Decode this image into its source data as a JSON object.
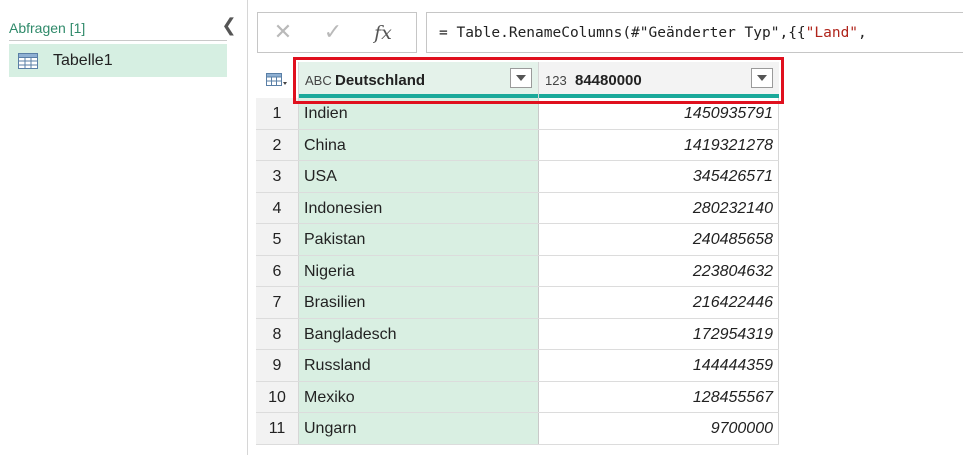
{
  "queries_pane": {
    "title": "Abfragen [1]",
    "collapse_glyph": "❮",
    "items": [
      {
        "label": "Tabelle1",
        "icon": "table-icon"
      }
    ]
  },
  "formula_bar": {
    "cancel_glyph": "✕",
    "commit_glyph": "✓",
    "fx_glyph": "fx",
    "formula_prefix": "= Table.RenameColumns(#\"Geänderter Typ\",{{",
    "formula_string": "\"Land\"",
    "formula_suffix": ","
  },
  "grid": {
    "columns": [
      {
        "type_label": "ABC",
        "name": "Deutschland"
      },
      {
        "type_label": "123",
        "name": "84480000"
      }
    ],
    "rows": [
      {
        "num": "1",
        "land": "Indien",
        "value": "1450935791"
      },
      {
        "num": "2",
        "land": "China",
        "value": "1419321278"
      },
      {
        "num": "3",
        "land": "USA",
        "value": "345426571"
      },
      {
        "num": "4",
        "land": "Indonesien",
        "value": "280232140"
      },
      {
        "num": "5",
        "land": "Pakistan",
        "value": "240485658"
      },
      {
        "num": "6",
        "land": "Nigeria",
        "value": "223804632"
      },
      {
        "num": "7",
        "land": "Brasilien",
        "value": "216422446"
      },
      {
        "num": "8",
        "land": "Bangladesch",
        "value": "172954319"
      },
      {
        "num": "9",
        "land": "Russland",
        "value": "144444359"
      },
      {
        "num": "10",
        "land": "Mexiko",
        "value": "128455567"
      },
      {
        "num": "11",
        "land": "Ungarn",
        "value": "9700000"
      }
    ]
  },
  "colors": {
    "accent": "#1aa99a",
    "selected_column": "#d9efe2",
    "highlight": "#e0101e"
  }
}
